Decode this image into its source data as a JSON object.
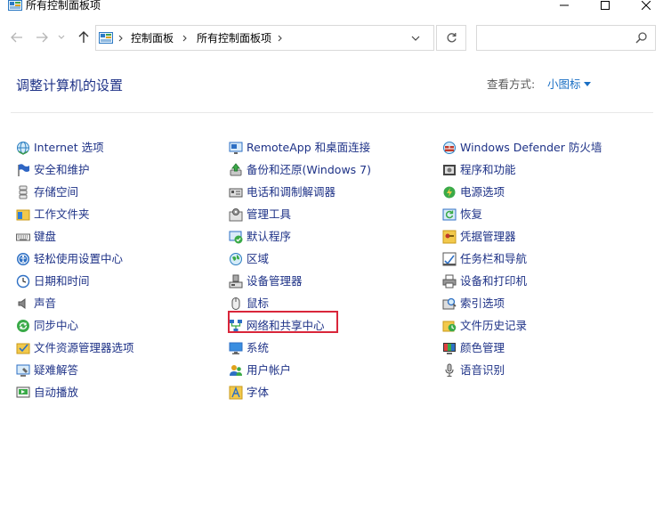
{
  "window": {
    "title": "所有控制面板项"
  },
  "address": {
    "crumbs": [
      "控制面板",
      "所有控制面板项"
    ],
    "search_placeholder": ""
  },
  "header": {
    "title": "调整计算机的设置",
    "view_by_label": "查看方式:",
    "view_by_value": "小图标"
  },
  "highlighted_item": "网络和共享中心",
  "items": {
    "col1": [
      {
        "label": "Internet 选项",
        "icon": "internet-options-icon"
      },
      {
        "label": "安全和维护",
        "icon": "security-flag-icon"
      },
      {
        "label": "存储空间",
        "icon": "storage-spaces-icon"
      },
      {
        "label": "工作文件夹",
        "icon": "work-folders-icon"
      },
      {
        "label": "键盘",
        "icon": "keyboard-icon"
      },
      {
        "label": "轻松使用设置中心",
        "icon": "ease-of-access-icon"
      },
      {
        "label": "日期和时间",
        "icon": "date-time-icon"
      },
      {
        "label": "声音",
        "icon": "sound-icon"
      },
      {
        "label": "同步中心",
        "icon": "sync-center-icon"
      },
      {
        "label": "文件资源管理器选项",
        "icon": "file-explorer-options-icon"
      },
      {
        "label": "疑难解答",
        "icon": "troubleshooting-icon"
      },
      {
        "label": "自动播放",
        "icon": "autoplay-icon"
      }
    ],
    "col2": [
      {
        "label": "RemoteApp 和桌面连接",
        "icon": "remoteapp-icon"
      },
      {
        "label": "备份和还原(Windows 7)",
        "icon": "backup-restore-icon"
      },
      {
        "label": "电话和调制解调器",
        "icon": "phone-modem-icon"
      },
      {
        "label": "管理工具",
        "icon": "admin-tools-icon"
      },
      {
        "label": "默认程序",
        "icon": "default-programs-icon"
      },
      {
        "label": "区域",
        "icon": "region-icon"
      },
      {
        "label": "设备管理器",
        "icon": "device-manager-icon"
      },
      {
        "label": "鼠标",
        "icon": "mouse-icon"
      },
      {
        "label": "网络和共享中心",
        "icon": "network-sharing-icon"
      },
      {
        "label": "系统",
        "icon": "system-icon"
      },
      {
        "label": "用户帐户",
        "icon": "user-accounts-icon"
      },
      {
        "label": "字体",
        "icon": "fonts-icon"
      }
    ],
    "col3": [
      {
        "label": "Windows Defender 防火墙",
        "icon": "firewall-icon"
      },
      {
        "label": "程序和功能",
        "icon": "programs-features-icon"
      },
      {
        "label": "电源选项",
        "icon": "power-options-icon"
      },
      {
        "label": "恢复",
        "icon": "recovery-icon"
      },
      {
        "label": "凭据管理器",
        "icon": "credential-manager-icon"
      },
      {
        "label": "任务栏和导航",
        "icon": "taskbar-icon"
      },
      {
        "label": "设备和打印机",
        "icon": "devices-printers-icon"
      },
      {
        "label": "索引选项",
        "icon": "indexing-options-icon"
      },
      {
        "label": "文件历史记录",
        "icon": "file-history-icon"
      },
      {
        "label": "颜色管理",
        "icon": "color-management-icon"
      },
      {
        "label": "语音识别",
        "icon": "speech-recognition-icon"
      }
    ]
  }
}
